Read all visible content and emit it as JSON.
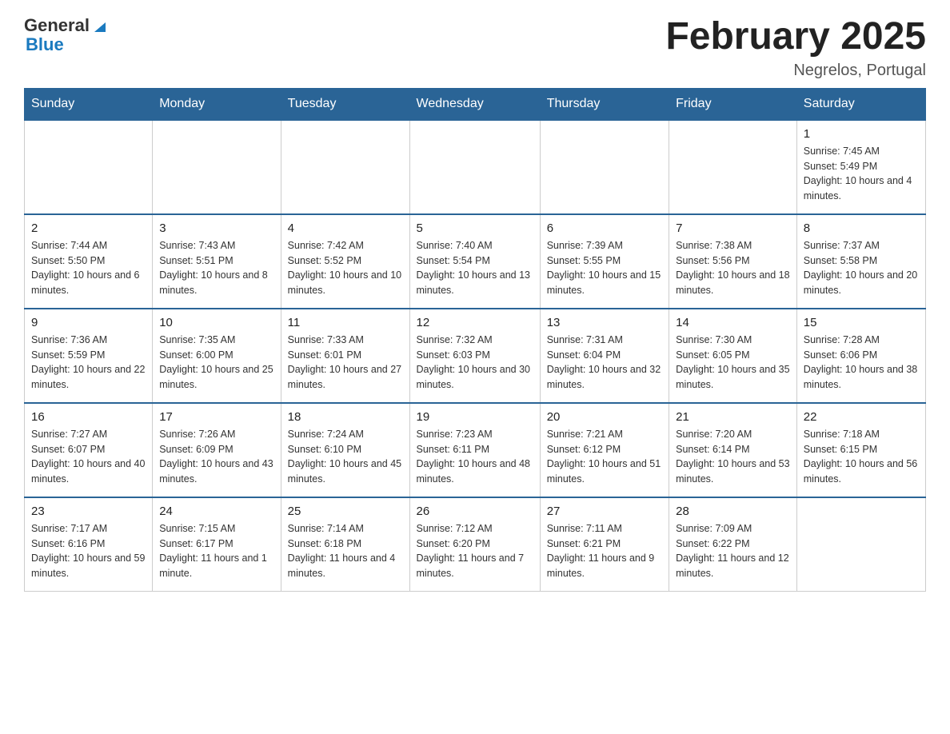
{
  "header": {
    "logo_general": "General",
    "logo_blue": "Blue",
    "month_title": "February 2025",
    "location": "Negrelos, Portugal"
  },
  "days_of_week": [
    "Sunday",
    "Monday",
    "Tuesday",
    "Wednesday",
    "Thursday",
    "Friday",
    "Saturday"
  ],
  "weeks": [
    [
      {
        "day": "",
        "info": ""
      },
      {
        "day": "",
        "info": ""
      },
      {
        "day": "",
        "info": ""
      },
      {
        "day": "",
        "info": ""
      },
      {
        "day": "",
        "info": ""
      },
      {
        "day": "",
        "info": ""
      },
      {
        "day": "1",
        "info": "Sunrise: 7:45 AM\nSunset: 5:49 PM\nDaylight: 10 hours and 4 minutes."
      }
    ],
    [
      {
        "day": "2",
        "info": "Sunrise: 7:44 AM\nSunset: 5:50 PM\nDaylight: 10 hours and 6 minutes."
      },
      {
        "day": "3",
        "info": "Sunrise: 7:43 AM\nSunset: 5:51 PM\nDaylight: 10 hours and 8 minutes."
      },
      {
        "day": "4",
        "info": "Sunrise: 7:42 AM\nSunset: 5:52 PM\nDaylight: 10 hours and 10 minutes."
      },
      {
        "day": "5",
        "info": "Sunrise: 7:40 AM\nSunset: 5:54 PM\nDaylight: 10 hours and 13 minutes."
      },
      {
        "day": "6",
        "info": "Sunrise: 7:39 AM\nSunset: 5:55 PM\nDaylight: 10 hours and 15 minutes."
      },
      {
        "day": "7",
        "info": "Sunrise: 7:38 AM\nSunset: 5:56 PM\nDaylight: 10 hours and 18 minutes."
      },
      {
        "day": "8",
        "info": "Sunrise: 7:37 AM\nSunset: 5:58 PM\nDaylight: 10 hours and 20 minutes."
      }
    ],
    [
      {
        "day": "9",
        "info": "Sunrise: 7:36 AM\nSunset: 5:59 PM\nDaylight: 10 hours and 22 minutes."
      },
      {
        "day": "10",
        "info": "Sunrise: 7:35 AM\nSunset: 6:00 PM\nDaylight: 10 hours and 25 minutes."
      },
      {
        "day": "11",
        "info": "Sunrise: 7:33 AM\nSunset: 6:01 PM\nDaylight: 10 hours and 27 minutes."
      },
      {
        "day": "12",
        "info": "Sunrise: 7:32 AM\nSunset: 6:03 PM\nDaylight: 10 hours and 30 minutes."
      },
      {
        "day": "13",
        "info": "Sunrise: 7:31 AM\nSunset: 6:04 PM\nDaylight: 10 hours and 32 minutes."
      },
      {
        "day": "14",
        "info": "Sunrise: 7:30 AM\nSunset: 6:05 PM\nDaylight: 10 hours and 35 minutes."
      },
      {
        "day": "15",
        "info": "Sunrise: 7:28 AM\nSunset: 6:06 PM\nDaylight: 10 hours and 38 minutes."
      }
    ],
    [
      {
        "day": "16",
        "info": "Sunrise: 7:27 AM\nSunset: 6:07 PM\nDaylight: 10 hours and 40 minutes."
      },
      {
        "day": "17",
        "info": "Sunrise: 7:26 AM\nSunset: 6:09 PM\nDaylight: 10 hours and 43 minutes."
      },
      {
        "day": "18",
        "info": "Sunrise: 7:24 AM\nSunset: 6:10 PM\nDaylight: 10 hours and 45 minutes."
      },
      {
        "day": "19",
        "info": "Sunrise: 7:23 AM\nSunset: 6:11 PM\nDaylight: 10 hours and 48 minutes."
      },
      {
        "day": "20",
        "info": "Sunrise: 7:21 AM\nSunset: 6:12 PM\nDaylight: 10 hours and 51 minutes."
      },
      {
        "day": "21",
        "info": "Sunrise: 7:20 AM\nSunset: 6:14 PM\nDaylight: 10 hours and 53 minutes."
      },
      {
        "day": "22",
        "info": "Sunrise: 7:18 AM\nSunset: 6:15 PM\nDaylight: 10 hours and 56 minutes."
      }
    ],
    [
      {
        "day": "23",
        "info": "Sunrise: 7:17 AM\nSunset: 6:16 PM\nDaylight: 10 hours and 59 minutes."
      },
      {
        "day": "24",
        "info": "Sunrise: 7:15 AM\nSunset: 6:17 PM\nDaylight: 11 hours and 1 minute."
      },
      {
        "day": "25",
        "info": "Sunrise: 7:14 AM\nSunset: 6:18 PM\nDaylight: 11 hours and 4 minutes."
      },
      {
        "day": "26",
        "info": "Sunrise: 7:12 AM\nSunset: 6:20 PM\nDaylight: 11 hours and 7 minutes."
      },
      {
        "day": "27",
        "info": "Sunrise: 7:11 AM\nSunset: 6:21 PM\nDaylight: 11 hours and 9 minutes."
      },
      {
        "day": "28",
        "info": "Sunrise: 7:09 AM\nSunset: 6:22 PM\nDaylight: 11 hours and 12 minutes."
      },
      {
        "day": "",
        "info": ""
      }
    ]
  ]
}
